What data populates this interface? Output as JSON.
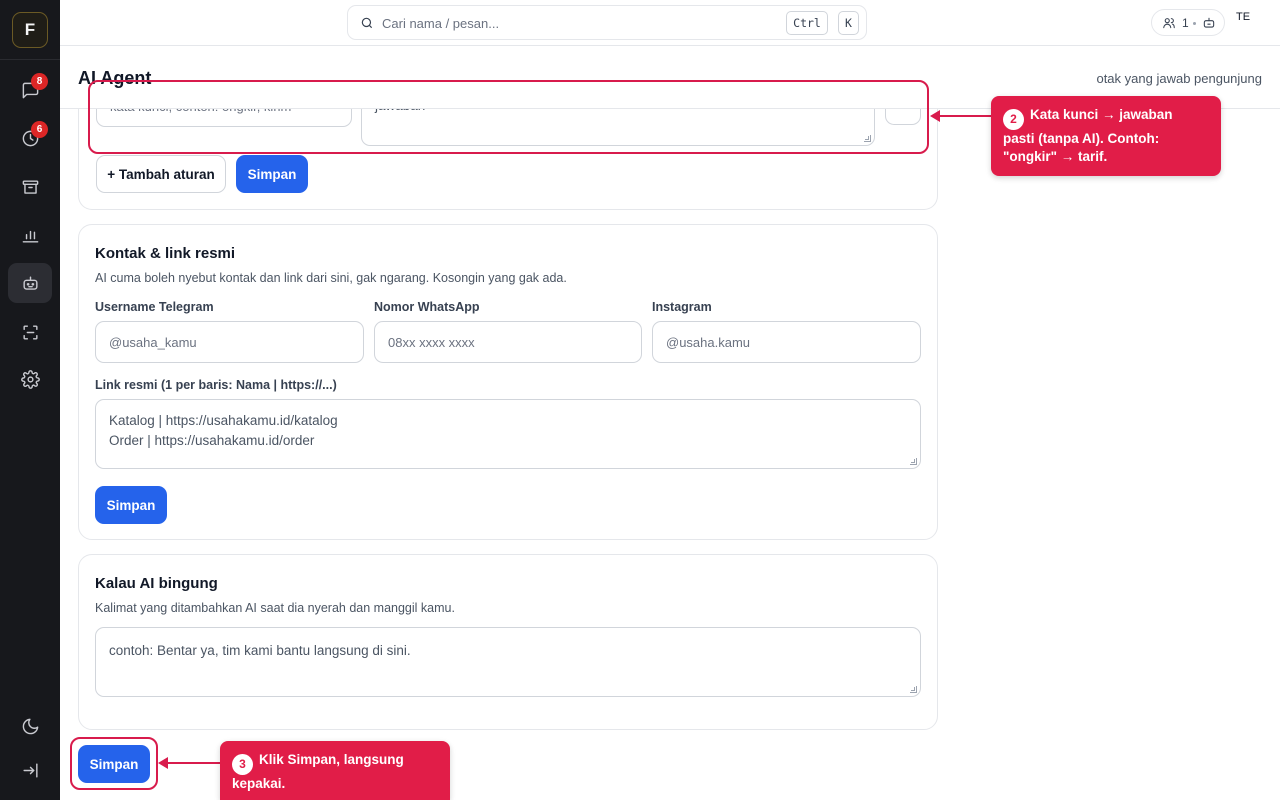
{
  "brand": {
    "logo_letter": "F"
  },
  "sidebar": {
    "items": [
      {
        "name": "chat-icon",
        "badge": "8"
      },
      {
        "name": "clock-icon",
        "badge": "6"
      },
      {
        "name": "archive-icon"
      },
      {
        "name": "chart-icon"
      },
      {
        "name": "bot-icon",
        "active": true
      },
      {
        "name": "scan-icon"
      },
      {
        "name": "gear-icon"
      }
    ],
    "bottom": [
      {
        "name": "moon-icon"
      },
      {
        "name": "collapse-icon"
      }
    ]
  },
  "topbar": {
    "search_placeholder": "Cari nama / pesan...",
    "shortcut_key1": "Ctrl",
    "shortcut_key2": "K",
    "presence_count": "1",
    "user_initials": "TE"
  },
  "page": {
    "title": "AI Agent",
    "subtitle": "otak yang jawab pengunjung"
  },
  "rules_card": {
    "keyword_placeholder": "kata kunci, contoh: ongkir, kirim",
    "answer_placeholder": "jawaban",
    "remove_label": "×",
    "add_rule_label": "+ Tambah aturan",
    "save_label": "Simpan"
  },
  "contacts_card": {
    "title": "Kontak & link resmi",
    "description": "AI cuma boleh nyebut kontak dan link dari sini, gak ngarang. Kosongin yang gak ada.",
    "telegram_label": "Username Telegram",
    "telegram_placeholder": "@usaha_kamu",
    "whatsapp_label": "Nomor WhatsApp",
    "whatsapp_placeholder": "08xx xxxx xxxx",
    "instagram_label": "Instagram",
    "instagram_placeholder": "@usaha.kamu",
    "links_label": "Link resmi (1 per baris: Nama | https://...)",
    "links_line1": "Katalog | https://usahakamu.id/katalog",
    "links_line2": "Order | https://usahakamu.id/order",
    "save_label": "Simpan"
  },
  "fallback_card": {
    "title": "Kalau AI bingung",
    "description": "Kalimat yang ditambahkan AI saat dia nyerah dan manggil kamu.",
    "placeholder": "contoh: Bentar ya, tim kami bantu langsung di sini."
  },
  "footer": {
    "save_label": "Simpan"
  },
  "callouts": {
    "step2": {
      "number": "2",
      "line1": "Kata kunci → jawaban",
      "line2": "pasti (tanpa AI). Contoh:",
      "line3": "\"ongkir\" → tarif."
    },
    "step3": {
      "number": "3",
      "line1": "Klik Simpan, langsung",
      "line2": "kepakai."
    }
  },
  "colors": {
    "accent": "#2563eb",
    "callout": "#e11d48",
    "sidebar": "#17181c",
    "badge": "#dc2626"
  }
}
